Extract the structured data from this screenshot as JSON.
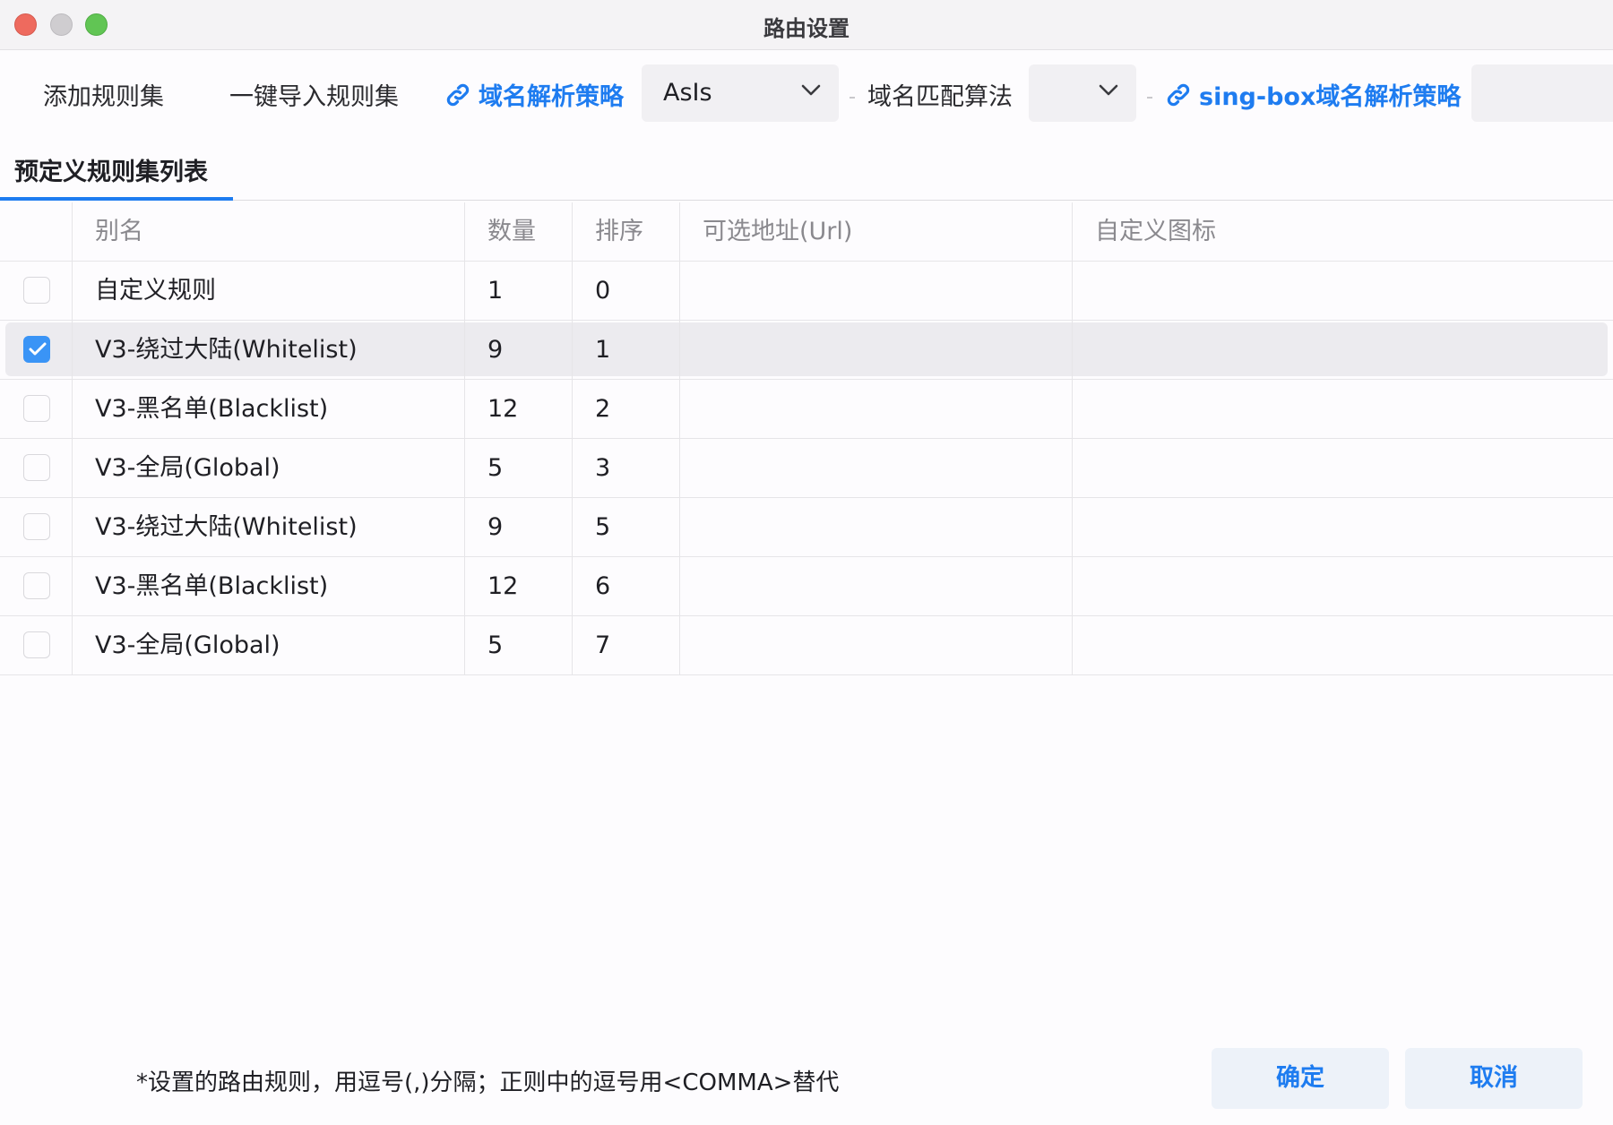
{
  "window": {
    "title": "路由设置"
  },
  "toolbar": {
    "add_ruleset": "添加规则集",
    "import_ruleset": "一键导入规则集",
    "domain_strategy_link": "域名解析策略",
    "domain_strategy_value": "AsIs",
    "domain_match_label": "域名匹配算法",
    "domain_match_value": "",
    "singbox_strategy_link": "sing-box域名解析策略",
    "singbox_strategy_value": ""
  },
  "tabs": [
    {
      "label": "预定义规则集列表",
      "active": true
    }
  ],
  "table": {
    "headers": [
      "别名",
      "数量",
      "排序",
      "可选地址(Url)",
      "自定义图标"
    ],
    "rows": [
      {
        "checked": false,
        "alias": "自定义规则",
        "count": "1",
        "order": "0",
        "url": "",
        "icon": ""
      },
      {
        "checked": true,
        "alias": "V3-绕过大陆(Whitelist)",
        "count": "9",
        "order": "1",
        "url": "",
        "icon": ""
      },
      {
        "checked": false,
        "alias": "V3-黑名单(Blacklist)",
        "count": "12",
        "order": "2",
        "url": "",
        "icon": ""
      },
      {
        "checked": false,
        "alias": "V3-全局(Global)",
        "count": "5",
        "order": "3",
        "url": "",
        "icon": ""
      },
      {
        "checked": false,
        "alias": "V3-绕过大陆(Whitelist)",
        "count": "9",
        "order": "5",
        "url": "",
        "icon": ""
      },
      {
        "checked": false,
        "alias": "V3-黑名单(Blacklist)",
        "count": "12",
        "order": "6",
        "url": "",
        "icon": ""
      },
      {
        "checked": false,
        "alias": "V3-全局(Global)",
        "count": "5",
        "order": "7",
        "url": "",
        "icon": ""
      }
    ]
  },
  "footer": {
    "note": "*设置的路由规则，用逗号(,)分隔；正则中的逗号用<COMMA>替代",
    "confirm": "确定",
    "cancel": "取消"
  },
  "colors": {
    "accent": "#1e7cf0",
    "checkbox_checked": "#3a94f6",
    "selected_row": "#ecebef"
  },
  "icons": {
    "link": "link-icon",
    "dropdown": "chevron-down-icon",
    "check": "checkmark-icon"
  }
}
